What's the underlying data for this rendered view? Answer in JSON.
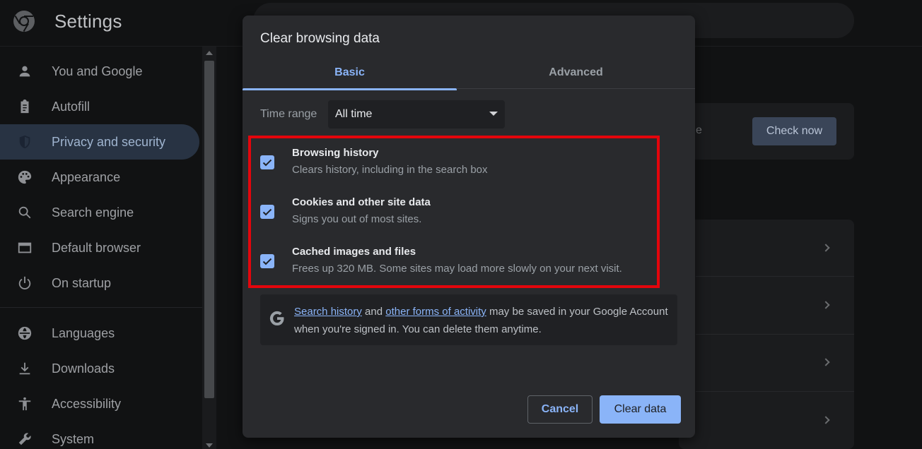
{
  "app": {
    "title": "Settings"
  },
  "sidebar": {
    "items": [
      {
        "label": "You and Google",
        "icon": "person-icon"
      },
      {
        "label": "Autofill",
        "icon": "clipboard-icon"
      },
      {
        "label": "Privacy and security",
        "icon": "shield-icon",
        "active": true
      },
      {
        "label": "Appearance",
        "icon": "palette-icon"
      },
      {
        "label": "Search engine",
        "icon": "search-icon"
      },
      {
        "label": "Default browser",
        "icon": "browser-icon"
      },
      {
        "label": "On startup",
        "icon": "power-icon"
      },
      {
        "label": "Languages",
        "icon": "globe-icon"
      },
      {
        "label": "Downloads",
        "icon": "download-icon"
      },
      {
        "label": "Accessibility",
        "icon": "accessibility-icon"
      },
      {
        "label": "System",
        "icon": "wrench-icon"
      }
    ]
  },
  "background": {
    "fragment_text": "e",
    "check_now_label": "Check now"
  },
  "dialog": {
    "title": "Clear browsing data",
    "tabs": [
      {
        "label": "Basic",
        "active": true
      },
      {
        "label": "Advanced",
        "active": false
      }
    ],
    "time_range": {
      "label": "Time range",
      "value": "All time"
    },
    "options": [
      {
        "title": "Browsing history",
        "description": "Clears history, including in the search box",
        "checked": true
      },
      {
        "title": "Cookies and other site data",
        "description": "Signs you out of most sites.",
        "checked": true
      },
      {
        "title": "Cached images and files",
        "description": "Frees up 320 MB. Some sites may load more slowly on your next visit.",
        "checked": true
      }
    ],
    "google_info": {
      "link1": "Search history",
      "and_text": "and",
      "link2": "other forms of activity",
      "rest_text": "may be saved in your Google Account when you're signed in. You can delete them anytime."
    },
    "cancel_label": "Cancel",
    "clear_label": "Clear data"
  },
  "colors": {
    "accent": "#8ab4f8",
    "highlight": "#e3050c",
    "dialog_bg": "#292a2d",
    "active_nav_bg": "#283343"
  }
}
